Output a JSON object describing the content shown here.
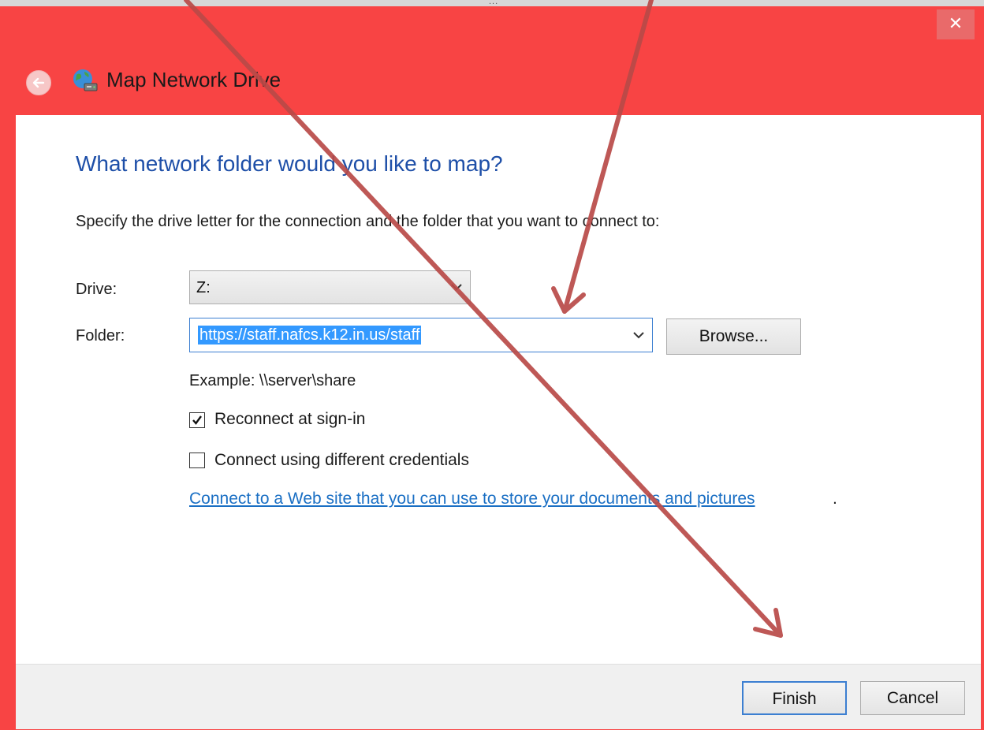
{
  "window": {
    "cropped_title": "...",
    "close_symbol": "✕",
    "title": "Map Network Drive"
  },
  "dialog": {
    "heading": "What network folder would you like to map?",
    "instruction": "Specify the drive letter for the connection and the folder that you want to connect to:",
    "drive_label": "Drive:",
    "drive_value": "Z:",
    "folder_label": "Folder:",
    "folder_value": "https://staff.nafcs.k12.in.us/staff",
    "browse_label": "Browse...",
    "example_text": "Example: \\\\server\\share",
    "reconnect_label": "Reconnect at sign-in",
    "reconnect_checked": true,
    "credentials_label": "Connect using different credentials",
    "credentials_checked": false,
    "web_link_text": "Connect to a Web site that you can use to store your documents and pictures",
    "web_link_suffix": "."
  },
  "footer": {
    "finish_label": "Finish",
    "cancel_label": "Cancel"
  },
  "icons": {
    "back": "back-arrow-icon",
    "network_drive": "network-drive-icon",
    "chevron": "chevron-down-icon",
    "check": "checkmark-icon"
  },
  "colors": {
    "frame_red": "#f84444",
    "heading_blue": "#1e4fa8",
    "link_blue": "#1a6fc4",
    "selection_blue": "#3399ff",
    "annotation_arrow": "#b94a48"
  }
}
